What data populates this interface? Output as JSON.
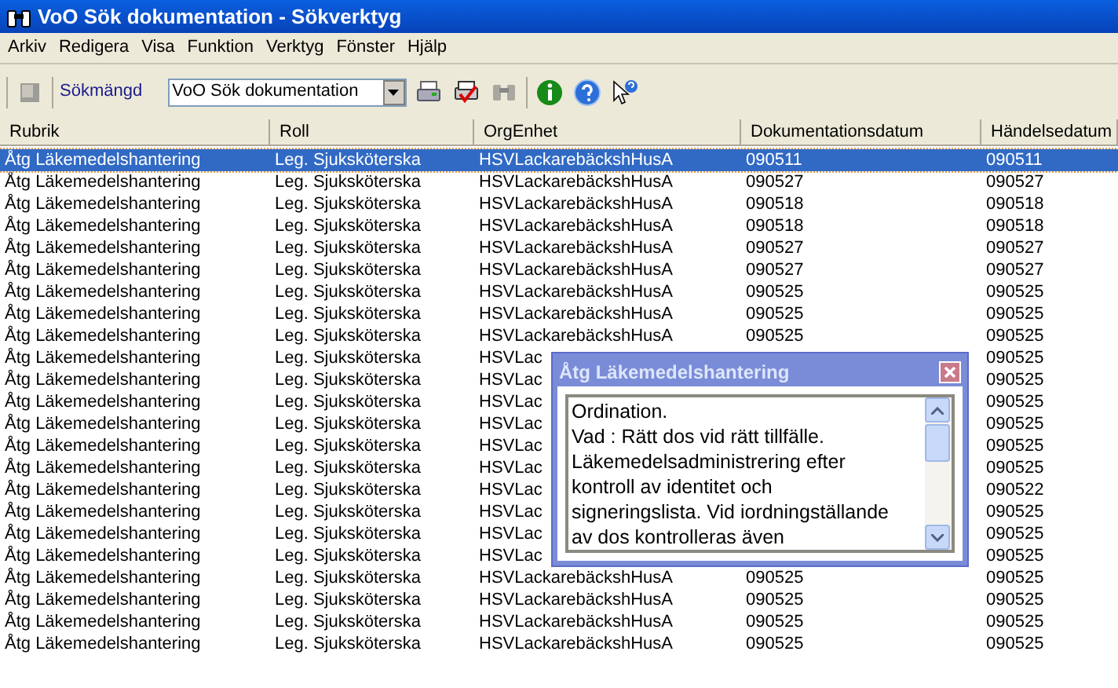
{
  "window": {
    "title": "VoO Sök dokumentation - Sökverktyg"
  },
  "menu": [
    "Arkiv",
    "Redigera",
    "Visa",
    "Funktion",
    "Verktyg",
    "Fönster",
    "Hjälp"
  ],
  "toolbar": {
    "label": "Sökmängd",
    "combo": {
      "value": "VoO Sök dokumentation"
    }
  },
  "table": {
    "columns": [
      "Rubrik",
      "Roll",
      "OrgEnhet",
      "Dokumentationsdatum",
      "Händelsedatum"
    ],
    "rows": [
      {
        "rubrik": "Åtg Läkemedelshantering",
        "roll": "Leg. Sjuksköterska",
        "org": "HSVLackarebäckshHusA",
        "doc": "090511",
        "handelse": "090511",
        "selected": true
      },
      {
        "rubrik": "Åtg Läkemedelshantering",
        "roll": "Leg. Sjuksköterska",
        "org": "HSVLackarebäckshHusA",
        "doc": "090527",
        "handelse": "090527",
        "selected": false
      },
      {
        "rubrik": "Åtg Läkemedelshantering",
        "roll": "Leg. Sjuksköterska",
        "org": "HSVLackarebäckshHusA",
        "doc": "090518",
        "handelse": "090518",
        "selected": false
      },
      {
        "rubrik": "Åtg Läkemedelshantering",
        "roll": "Leg. Sjuksköterska",
        "org": "HSVLackarebäckshHusA",
        "doc": "090518",
        "handelse": "090518",
        "selected": false
      },
      {
        "rubrik": "Åtg Läkemedelshantering",
        "roll": "Leg. Sjuksköterska",
        "org": "HSVLackarebäckshHusA",
        "doc": "090527",
        "handelse": "090527",
        "selected": false
      },
      {
        "rubrik": "Åtg Läkemedelshantering",
        "roll": "Leg. Sjuksköterska",
        "org": "HSVLackarebäckshHusA",
        "doc": "090527",
        "handelse": "090527",
        "selected": false
      },
      {
        "rubrik": "Åtg Läkemedelshantering",
        "roll": "Leg. Sjuksköterska",
        "org": "HSVLackarebäckshHusA",
        "doc": "090525",
        "handelse": "090525",
        "selected": false
      },
      {
        "rubrik": "Åtg Läkemedelshantering",
        "roll": "Leg. Sjuksköterska",
        "org": "HSVLackarebäckshHusA",
        "doc": "090525",
        "handelse": "090525",
        "selected": false
      },
      {
        "rubrik": "Åtg Läkemedelshantering",
        "roll": "Leg. Sjuksköterska",
        "org": "HSVLackarebäckshHusA",
        "doc": "090525",
        "handelse": "090525",
        "selected": false
      },
      {
        "rubrik": "Åtg Läkemedelshantering",
        "roll": "Leg. Sjuksköterska",
        "org": "HSVLac",
        "handelse": "090525",
        "selected": false
      },
      {
        "rubrik": "Åtg Läkemedelshantering",
        "roll": "Leg. Sjuksköterska",
        "org": "HSVLac",
        "handelse": "090525",
        "selected": false
      },
      {
        "rubrik": "Åtg Läkemedelshantering",
        "roll": "Leg. Sjuksköterska",
        "org": "HSVLac",
        "handelse": "090525",
        "selected": false
      },
      {
        "rubrik": "Åtg Läkemedelshantering",
        "roll": "Leg. Sjuksköterska",
        "org": "HSVLac",
        "handelse": "090525",
        "selected": false
      },
      {
        "rubrik": "Åtg Läkemedelshantering",
        "roll": "Leg. Sjuksköterska",
        "org": "HSVLac",
        "handelse": "090525",
        "selected": false
      },
      {
        "rubrik": "Åtg Läkemedelshantering",
        "roll": "Leg. Sjuksköterska",
        "org": "HSVLac",
        "handelse": "090525",
        "selected": false
      },
      {
        "rubrik": "Åtg Läkemedelshantering",
        "roll": "Leg. Sjuksköterska",
        "org": "HSVLac",
        "handelse": "090522",
        "selected": false
      },
      {
        "rubrik": "Åtg Läkemedelshantering",
        "roll": "Leg. Sjuksköterska",
        "org": "HSVLac",
        "handelse": "090525",
        "selected": false
      },
      {
        "rubrik": "Åtg Läkemedelshantering",
        "roll": "Leg. Sjuksköterska",
        "org": "HSVLac",
        "handelse": "090525",
        "selected": false
      },
      {
        "rubrik": "Åtg Läkemedelshantering",
        "roll": "Leg. Sjuksköterska",
        "org": "HSVLac",
        "handelse": "090525",
        "selected": false
      },
      {
        "rubrik": "Åtg Läkemedelshantering",
        "roll": "Leg. Sjuksköterska",
        "org": "HSVLackarebäckshHusA",
        "doc": "090525",
        "handelse": "090525",
        "selected": false
      },
      {
        "rubrik": "Åtg Läkemedelshantering",
        "roll": "Leg. Sjuksköterska",
        "org": "HSVLackarebäckshHusA",
        "doc": "090525",
        "handelse": "090525",
        "selected": false
      },
      {
        "rubrik": "Åtg Läkemedelshantering",
        "roll": "Leg. Sjuksköterska",
        "org": "HSVLackarebäckshHusA",
        "doc": "090525",
        "handelse": "090525",
        "selected": false
      },
      {
        "rubrik": "Åtg Läkemedelshantering",
        "roll": "Leg. Sjuksköterska",
        "org": "HSVLackarebäckshHusA",
        "doc": "090525",
        "handelse": "090525",
        "selected": false
      }
    ]
  },
  "popup": {
    "title": "Åtg Läkemedelshantering",
    "text": "Ordination.\nVad : Rätt dos vid rätt tillfälle.\nLäkemedelsadministrering efter\nkontroll av  identitet och\nsigneringslista. Vid iordningställande\nav dos kontrolleras även"
  }
}
